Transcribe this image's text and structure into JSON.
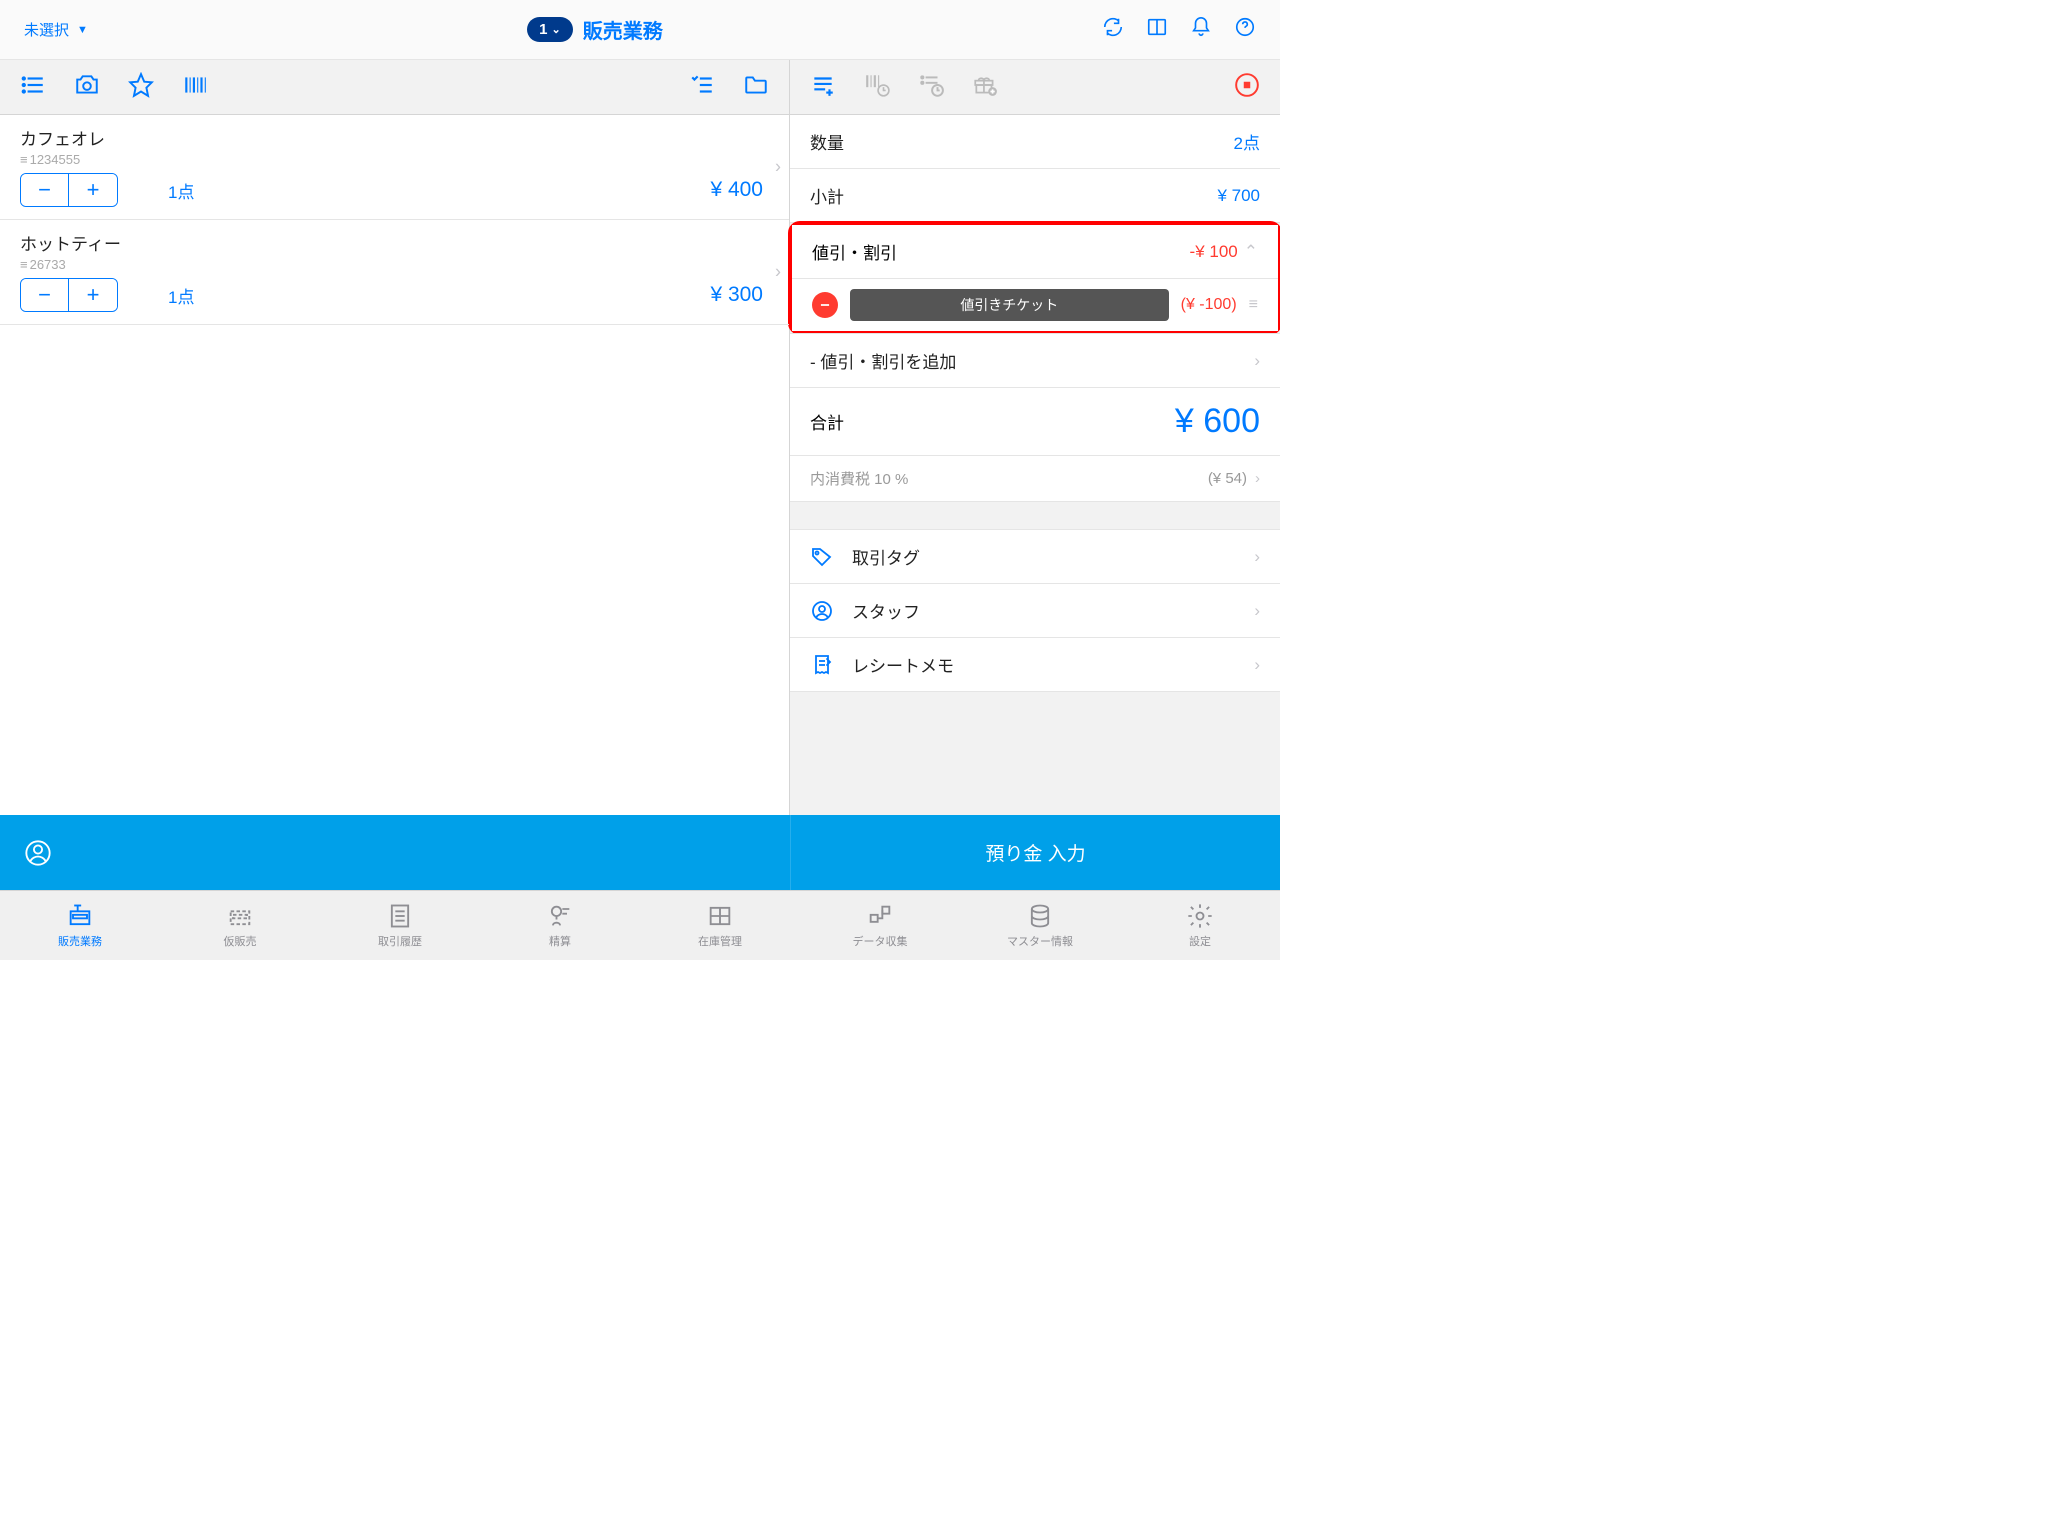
{
  "header": {
    "unselected": "未選択",
    "badge": "1",
    "title": "販売業務"
  },
  "items": [
    {
      "name": "カフェオレ",
      "code": "1234555",
      "qty": "1点",
      "price": "¥ 400"
    },
    {
      "name": "ホットティー",
      "code": "26733",
      "qty": "1点",
      "price": "¥ 300"
    }
  ],
  "summary": {
    "qty_label": "数量",
    "qty_value": "2点",
    "subtotal_label": "小計",
    "subtotal_value": "¥ 700",
    "discount_label": "値引・割引",
    "discount_value": "-¥ 100",
    "discount_ticket": "値引きチケット",
    "discount_ticket_amt": "(¥ -100)",
    "add_discount": "- 値引・割引を追加",
    "total_label": "合計",
    "total_value": "¥ 600",
    "tax_label": "内消費税 10 %",
    "tax_value": "(¥ 54)",
    "tag_label": "取引タグ",
    "staff_label": "スタッフ",
    "memo_label": "レシートメモ"
  },
  "footer": {
    "deposit": "預り金 入力"
  },
  "tabs": [
    {
      "label": "販売業務",
      "active": true
    },
    {
      "label": "仮販売"
    },
    {
      "label": "取引履歴"
    },
    {
      "label": "精算"
    },
    {
      "label": "在庫管理"
    },
    {
      "label": "データ収集"
    },
    {
      "label": "マスター情報"
    },
    {
      "label": "設定"
    }
  ]
}
